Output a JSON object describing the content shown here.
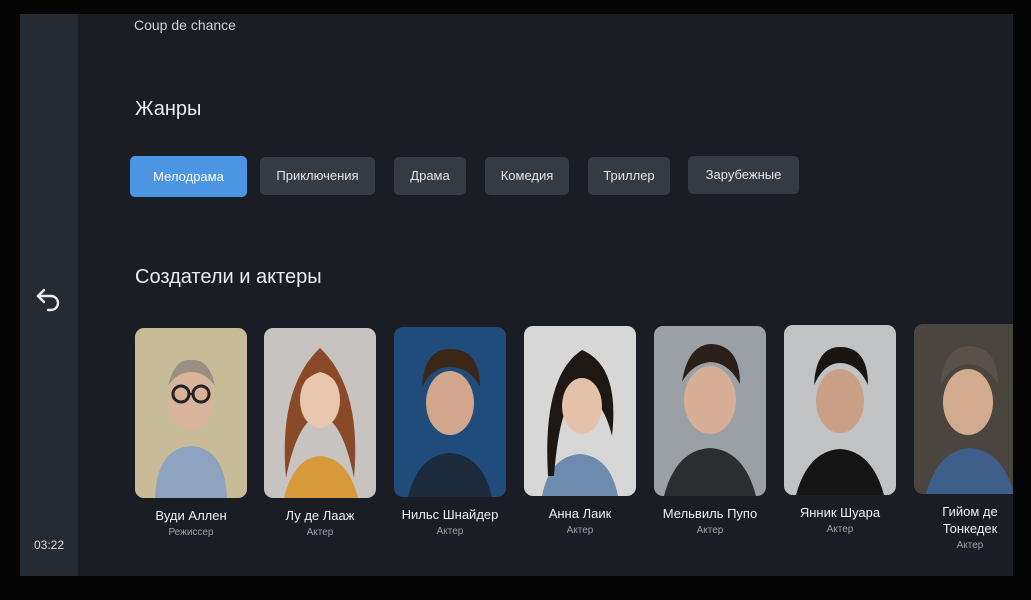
{
  "breadcrumb": "Coup de chance",
  "genres": {
    "title": "Жанры",
    "items": [
      {
        "label": "Мелодрама",
        "active": true
      },
      {
        "label": "Приключения",
        "active": false
      },
      {
        "label": "Драма",
        "active": false
      },
      {
        "label": "Комедия",
        "active": false
      },
      {
        "label": "Триллер",
        "active": false
      },
      {
        "label": "Зарубежные",
        "active": false
      }
    ]
  },
  "cast": {
    "title": "Создатели и актеры",
    "people": [
      {
        "name": "Вуди Аллен",
        "role": "Режиссер"
      },
      {
        "name": "Лу де Лааж",
        "role": "Актер"
      },
      {
        "name": "Нильс Шнайдер",
        "role": "Актер"
      },
      {
        "name": "Анна Лаик",
        "role": "Актер"
      },
      {
        "name": "Мельвиль Пупо",
        "role": "Актер"
      },
      {
        "name": "Янник Шуара",
        "role": "Актер"
      },
      {
        "name": "Гийом де Тонкедек",
        "role": "Актер"
      }
    ]
  },
  "sidebar": {
    "back_icon": "back-arrow-icon",
    "clock": "03:22"
  },
  "colors": {
    "accent": "#4b95e3",
    "background": "#1a1d24",
    "chip": "#353a45"
  }
}
